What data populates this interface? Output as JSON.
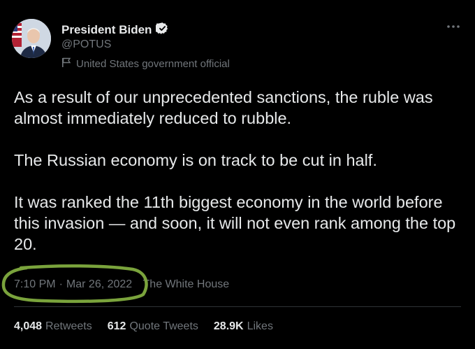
{
  "author": {
    "name": "President Biden",
    "handle": "@POTUS",
    "label": "United States government official",
    "verified_color": "#e7e9ea"
  },
  "icons": [
    "verified-badge-icon",
    "flag-icon",
    "more-icon"
  ],
  "tweet": {
    "paragraphs": [
      "As a result of our unprecedented sanctions, the ruble was almost immediately reduced to rubble.",
      "The Russian economy is on track to be cut in half.",
      "It was ranked the 11th biggest economy in the world before this invasion — and soon, it will not even rank among the top 20."
    ]
  },
  "meta": {
    "time": "7:10 PM",
    "separator": "·",
    "date": "Mar 26, 2022",
    "source": "The White House",
    "annotation_color": "#7aa33c"
  },
  "stats": {
    "retweets": {
      "count": "4,048",
      "label": "Retweets"
    },
    "quotes": {
      "count": "612",
      "label": "Quote Tweets"
    },
    "likes": {
      "count": "28.9K",
      "label": "Likes"
    }
  },
  "colors": {
    "background": "#000000",
    "text": "#e7e9ea",
    "muted": "#71767b",
    "divider": "#2f3336"
  }
}
